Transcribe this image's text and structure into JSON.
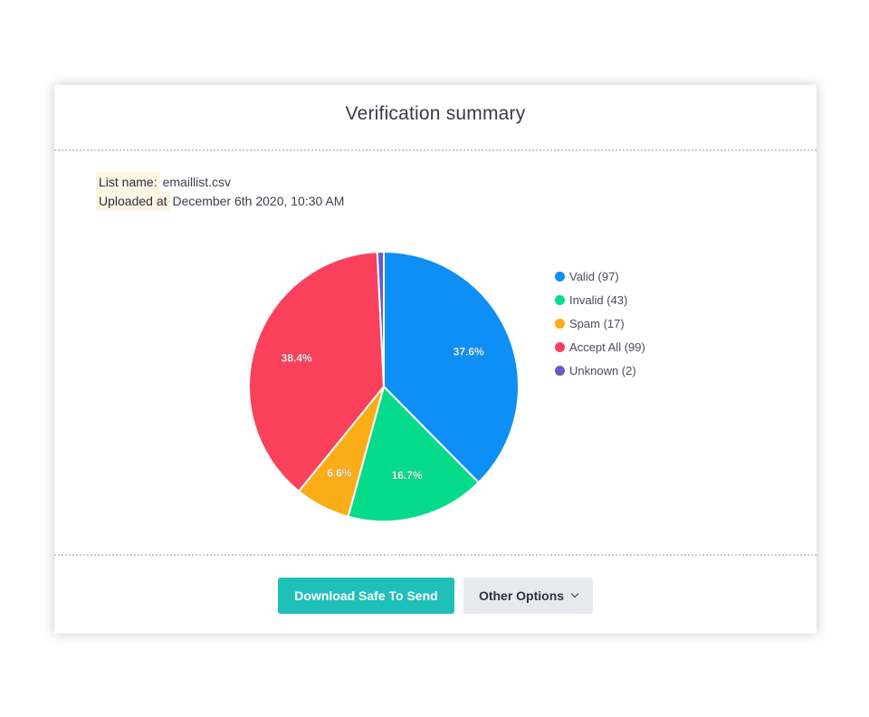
{
  "title": "Verification summary",
  "meta": {
    "list_name_label": "List name:",
    "list_name_value": "emaillist.csv",
    "uploaded_label": "Uploaded at",
    "uploaded_value": "December 6th 2020, 10:30 AM"
  },
  "chart_data": {
    "type": "pie",
    "categories": [
      "Valid",
      "Invalid",
      "Spam",
      "Accept All",
      "Unknown"
    ],
    "values": [
      97,
      43,
      17,
      99,
      2
    ],
    "colors": [
      "#0d8ff5",
      "#05db8b",
      "#fbad18",
      "#fb405c",
      "#6c58cd"
    ],
    "slice_labels": [
      "37.6%",
      "16.7%",
      "6.6%",
      "38.4%",
      ""
    ],
    "legend": [
      "Valid (97)",
      "Invalid (43)",
      "Spam (17)",
      "Accept All (99)",
      "Unknown (2)"
    ],
    "legend_position": "right",
    "start_angle": "top",
    "direction": "clockwise"
  },
  "buttons": {
    "download_label": "Download Safe To Send",
    "other_options_label": "Other Options",
    "other_options_icon": "chevron-down-icon"
  }
}
